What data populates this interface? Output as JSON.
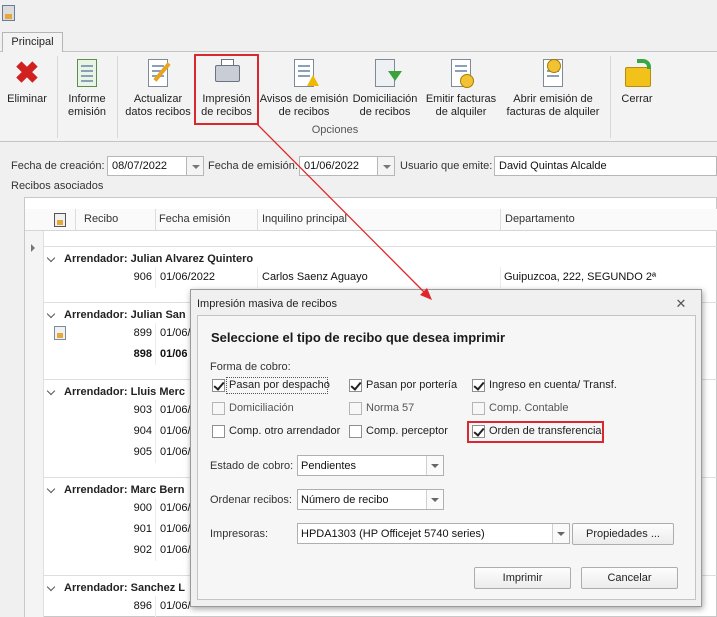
{
  "tabs": {
    "principal": "Principal"
  },
  "ribbon": {
    "group_label": "Opciones",
    "buttons": {
      "eliminar": "Eliminar",
      "informe": "Informe\nemisión",
      "actualizar": "Actualizar\ndatos recibos",
      "impresion": "Impresión\nde recibos",
      "avisos": "Avisos de emisión\nde recibos",
      "domiciliacion": "Domiciliación\nde recibos",
      "emitir": "Emitir facturas\nde alquiler",
      "abrir": "Abrir emisión de\nfacturas de alquiler",
      "cerrar": "Cerrar"
    }
  },
  "header": {
    "creacion_label": "Fecha de creación:",
    "creacion_value": "08/07/2022",
    "emision_label": "Fecha de emisión:",
    "emision_value": "01/06/2022",
    "usuario_label": "Usuario que emite:",
    "usuario_value": "David Quintas Alcalde",
    "recibos_label": "Recibos asociados"
  },
  "grid": {
    "columns": {
      "recibo": "Recibo",
      "fecha": "Fecha emisión",
      "inquilino": "Inquilino principal",
      "departamento": "Departamento"
    },
    "groups": {
      "g1": "Arrendador: Julian Alvarez Quintero",
      "g2": "Arrendador: Julian San",
      "g3": "Arrendador: Lluis Merc",
      "g4": "Arrendador: Marc Bern",
      "g5": "Arrendador: Sanchez L"
    },
    "rows": {
      "r906": {
        "num": "906",
        "fecha": "01/06/2022",
        "inquilino": "Carlos Saenz Aguayo",
        "dep": "Guipuzcoa, 222, SEGUNDO 2ª"
      },
      "r899": {
        "num": "899",
        "fecha": "01/06/"
      },
      "r898": {
        "num": "898",
        "fecha": "01/06"
      },
      "r903": {
        "num": "903",
        "fecha": "01/06/"
      },
      "r904": {
        "num": "904",
        "fecha": "01/06/"
      },
      "r905": {
        "num": "905",
        "fecha": "01/06/"
      },
      "r900": {
        "num": "900",
        "fecha": "01/06/"
      },
      "r901": {
        "num": "901",
        "fecha": "01/06/"
      },
      "r902": {
        "num": "902",
        "fecha": "01/06/"
      },
      "r896": {
        "num": "896",
        "fecha": "01/06/"
      }
    }
  },
  "dialog": {
    "title": "Impresión masiva de recibos",
    "heading": "Seleccione el tipo de recibo que desea imprimir",
    "forma_label": "Forma de cobro:",
    "checks": {
      "despacho": {
        "label": "Pasan por despacho",
        "checked": true
      },
      "porteria": {
        "label": "Pasan por portería",
        "checked": true
      },
      "ingreso": {
        "label": "Ingreso en cuenta/ Transf.",
        "checked": true
      },
      "domiciliacion": {
        "label": "Domiciliación",
        "checked": false
      },
      "norma57": {
        "label": "Norma 57",
        "checked": false
      },
      "contable": {
        "label": "Comp. Contable",
        "checked": false
      },
      "otro": {
        "label": "Comp. otro arrendador",
        "checked": false
      },
      "perceptor": {
        "label": "Comp. perceptor",
        "checked": false
      },
      "orden": {
        "label": "Orden de transferencia",
        "checked": true
      }
    },
    "estado_label": "Estado de cobro:",
    "estado_value": "Pendientes",
    "ordenar_label": "Ordenar recibos:",
    "ordenar_value": "Número de recibo",
    "impresoras_label": "Impresoras:",
    "impresoras_value": "HPDA1303 (HP Officejet 5740 series)",
    "propiedades": "Propiedades ...",
    "imprimir": "Imprimir",
    "cancelar": "Cancelar"
  },
  "colors": {
    "highlight": "#d9282f"
  }
}
